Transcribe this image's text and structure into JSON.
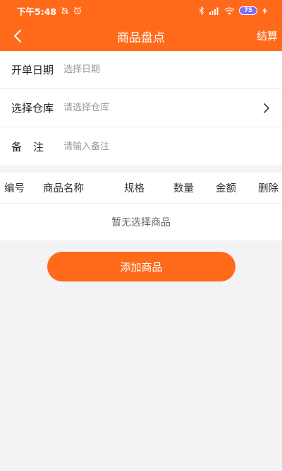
{
  "status_bar": {
    "time": "下午5:48",
    "battery_level": "75"
  },
  "nav": {
    "title": "商品盘点",
    "settle_label": "结算"
  },
  "form": {
    "open_date_label": "开单日期",
    "open_date_placeholder": "选择日期",
    "warehouse_label": "选择仓库",
    "warehouse_placeholder": "请选择仓库",
    "remark_label": "备注",
    "remark_placeholder": "请输入备注"
  },
  "table": {
    "columns": [
      "编号",
      "商品名称",
      "规格",
      "数量",
      "金额",
      "删除"
    ],
    "empty_text": "暂无选择商品"
  },
  "actions": {
    "add_product_label": "添加商品"
  },
  "colors": {
    "brand": "#ff6a1a",
    "background": "#f3f3f5"
  }
}
